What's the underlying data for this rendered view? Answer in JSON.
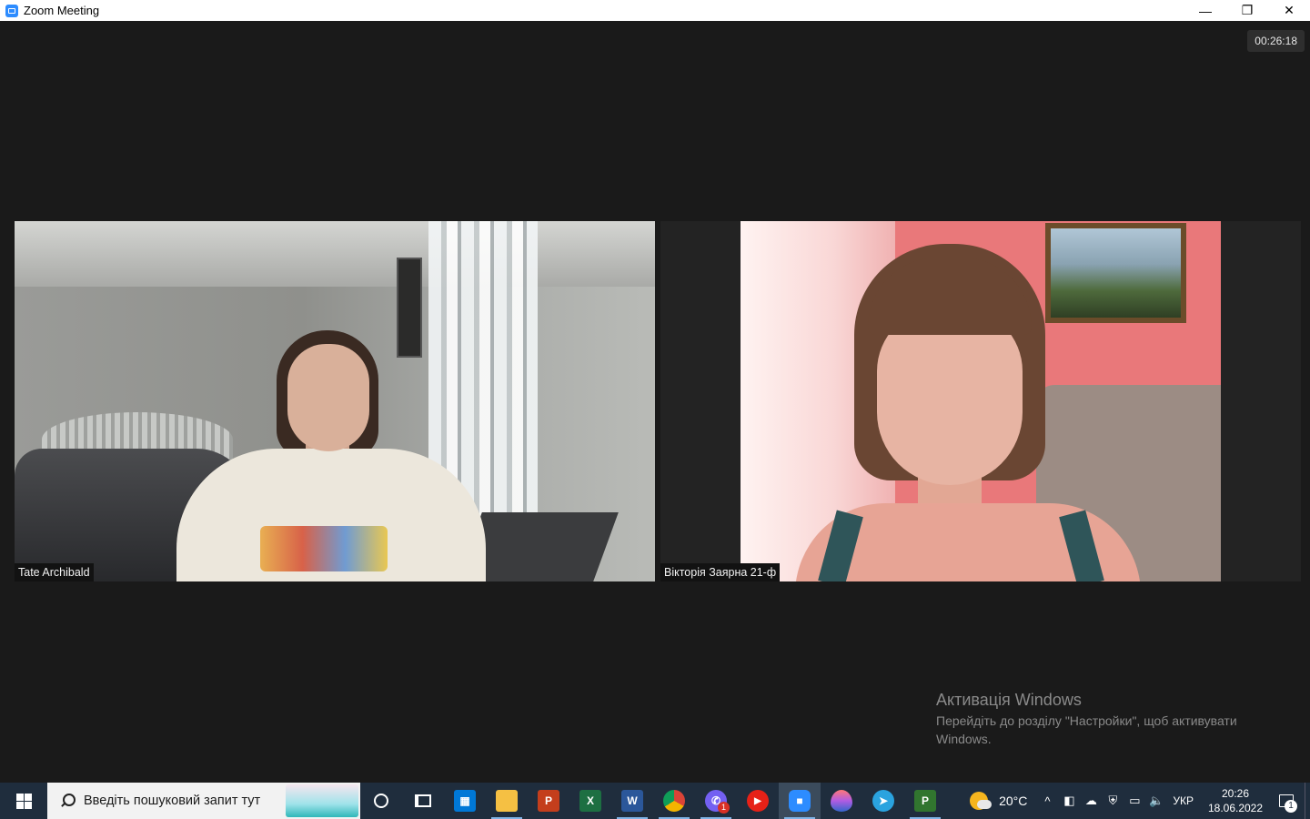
{
  "window": {
    "title": "Zoom Meeting",
    "controls": {
      "minimize": "—",
      "restore": "❐",
      "close": "✕"
    }
  },
  "meeting": {
    "timer": "00:26:18",
    "participants": [
      {
        "name": "Tate Archibald"
      },
      {
        "name": "Вікторія Заярна 21-ф"
      }
    ]
  },
  "activation": {
    "title": "Активація Windows",
    "line1": "Перейдіть до розділу \"Настройки\", щоб активувати",
    "line2": "Windows."
  },
  "taskbar": {
    "search_placeholder": "Введіть пошуковий запит тут",
    "apps": [
      {
        "name": "store-icon",
        "letter": "",
        "color": "#0078d7"
      },
      {
        "name": "file-explorer-icon",
        "letter": "",
        "color": "#f5c043"
      },
      {
        "name": "powerpoint-icon",
        "letter": "P",
        "color": "#c43e1c"
      },
      {
        "name": "excel-icon",
        "letter": "X",
        "color": "#1d6f42"
      },
      {
        "name": "word-icon",
        "letter": "W",
        "color": "#2b579a"
      },
      {
        "name": "chrome-icon",
        "letter": "",
        "color": "#db4437"
      },
      {
        "name": "viber-icon",
        "letter": "",
        "color": "#7360f2"
      },
      {
        "name": "youtube-music-icon",
        "letter": "▶",
        "color": "#e62117"
      },
      {
        "name": "zoom-icon",
        "letter": "",
        "color": "#2d8cff"
      },
      {
        "name": "drop-app-icon",
        "letter": "",
        "color": "#b05ce3"
      },
      {
        "name": "telegram-icon",
        "letter": "➤",
        "color": "#2aa3df"
      },
      {
        "name": "project-icon",
        "letter": "P",
        "color": "#31752f"
      }
    ],
    "viber_badge": "1",
    "weather_temp": "20°C",
    "language": "УКР",
    "time": "20:26",
    "date": "18.06.2022",
    "notifications": "1",
    "tray_icons": {
      "chevron": "^",
      "meet": "◧",
      "cloud": "☁",
      "security": "⛨",
      "network": "▭",
      "volume": "🔈"
    }
  }
}
